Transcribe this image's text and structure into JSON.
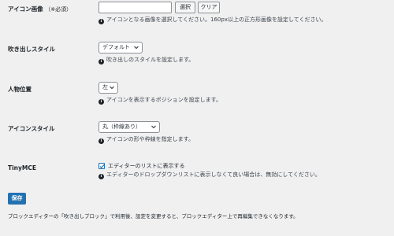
{
  "icon_image": {
    "label": "アイコン画像",
    "required": "（※必須）",
    "value": "",
    "select_button": "選択",
    "clear_button": "クリア",
    "help": "アイコンとなる画像を選択してください。160px以上の正方形画像を設定してください。"
  },
  "bubble_style": {
    "label": "吹き出しスタイル",
    "selected": "デフォルト",
    "help": "吹き出しのスタイルを設定します。"
  },
  "person_position": {
    "label": "人物位置",
    "selected": "左",
    "help": "アイコンを表示するポジションを設定します。"
  },
  "icon_style": {
    "label": "アイコンスタイル",
    "selected": "丸（枠線あり）",
    "help": "アイコンの形や枠線を指定します。"
  },
  "tinymce": {
    "label": "TinyMCE",
    "checkbox_label": "エディターのリストに表示する",
    "checked": true,
    "help": "エディターのドロップダウンリストに表示しなくて良い場合は、無効にしてください。"
  },
  "save_button": "保存",
  "footer_note": "ブロックエディターの「吹き出しブロック」で利用後、設定を変更すると、ブロックエディター上で再編集できなくなります。",
  "colors": {
    "primary": "#2271b1",
    "background": "#f0f0f1",
    "text": "#1d2327"
  }
}
